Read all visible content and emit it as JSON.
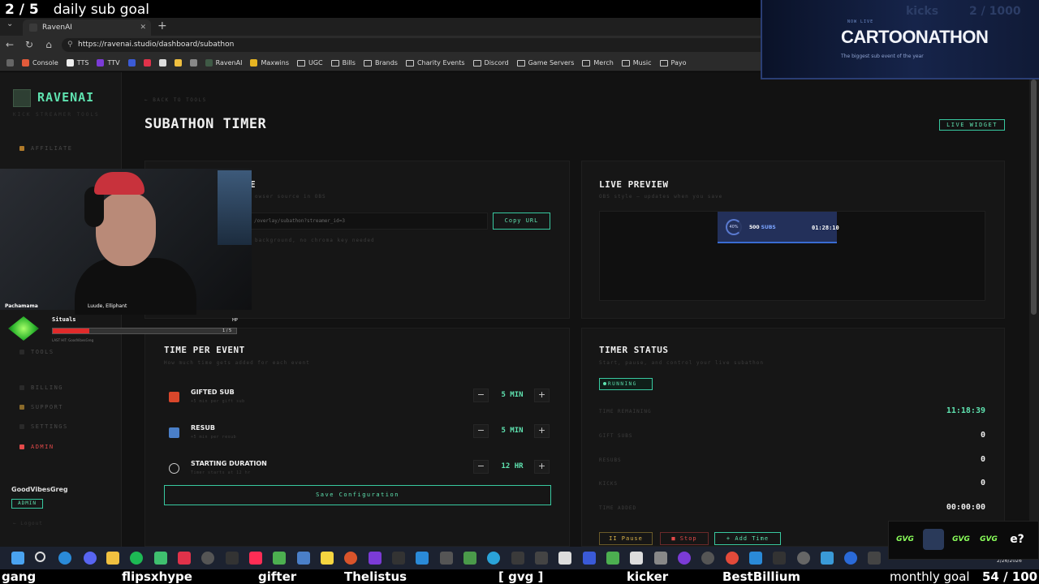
{
  "stream_overlay": {
    "goal_count": "2 / 5",
    "goal_label": "daily sub goal",
    "ticker": [
      "gang",
      "flipsxhype",
      "gifter",
      "Thelistus",
      "[ gvg ]",
      "kicker",
      "BestBillium",
      "monthly goal",
      "54 / 100"
    ]
  },
  "event_banner": {
    "kicker": "NOW LIVE",
    "title": "CARTOONATHON",
    "subtitle": "The biggest sub event of the year",
    "stat_label": "kicks",
    "stat_value": "2 / 1000"
  },
  "browser": {
    "tab_title": "RavenAI",
    "url": "https://ravenai.studio/dashboard/subathon",
    "bookmarks": [
      "Console",
      "TTS",
      "TTV",
      "RavenAI",
      "Maxwins",
      "UGC",
      "Bills",
      "Brands",
      "Charity Events",
      "Discord",
      "Game Servers",
      "Merch",
      "Music",
      "Payo"
    ]
  },
  "sidebar": {
    "brand": "RAVENAI",
    "brand_sub": "KICK STREAMER TOOLS",
    "items": [
      "AFFILIATE",
      "TOOLS",
      "BILLING",
      "SUPPORT",
      "SETTINGS",
      "ADMIN"
    ],
    "username": "GoodVibesGreg",
    "role_badge": "ADMIN",
    "logout": "← Logout"
  },
  "header": {
    "back_link": "← BACK TO TOOLS",
    "title": "SUBATHON TIMER",
    "live_widget_button": "LIVE WIDGET"
  },
  "source_card": {
    "title_partial": "E",
    "subtitle_partial": "owser source in OBS",
    "url_partial": "/overlay/subathon?streamer_id=3",
    "copy_button": "Copy URL",
    "note_partial": "background, no chroma key needed"
  },
  "preview_card": {
    "title": "LIVE PREVIEW",
    "subtitle": "OBS style — updates when you save",
    "widget_percent": "40%",
    "widget_subs_num": "500",
    "widget_subs_unit": "SUBS",
    "widget_time": "01:28:10"
  },
  "time_per_event": {
    "title": "TIME PER EVENT",
    "subtitle": "How much time gets added for each event",
    "rows": [
      {
        "name": "GIFTED SUB",
        "desc": "+5 min per gift sub",
        "value": "5 MIN"
      },
      {
        "name": "RESUB",
        "desc": "+5 min per resub",
        "value": "5 MIN"
      },
      {
        "name": "STARTING DURATION",
        "desc": "Timer starts at 12 hr",
        "value": "12 HR"
      }
    ],
    "save_button": "Save Configuration"
  },
  "timer_status": {
    "title": "TIMER STATUS",
    "subtitle": "Start, pause, and control your live subathon",
    "state": "RUNNING",
    "stats": [
      {
        "label": "TIME REMAINING",
        "value": "11:18:39"
      },
      {
        "label": "GIFT SUBS",
        "value": "0"
      },
      {
        "label": "RESUBS",
        "value": "0"
      },
      {
        "label": "KICKS",
        "value": "0"
      },
      {
        "label": "TIME ADDED",
        "value": "00:00:00"
      }
    ],
    "pause_button": "II Pause",
    "stop_button": "■ Stop",
    "add_time_button": "+ Add Time"
  },
  "webcam": {
    "name_left": "Pachamama",
    "name_right": "Luude, Elliphant",
    "hp_name": "Situals",
    "hp_tag": "HP",
    "hp_count": "1 / 5",
    "hp_fill_fraction": 0.2,
    "last_hit": "LAST HIT: GoodVibesGreg"
  },
  "taskbar": {
    "date": "2/26/2026",
    "emotes": [
      "GVG",
      "GVG",
      "GVG",
      "e?"
    ]
  }
}
